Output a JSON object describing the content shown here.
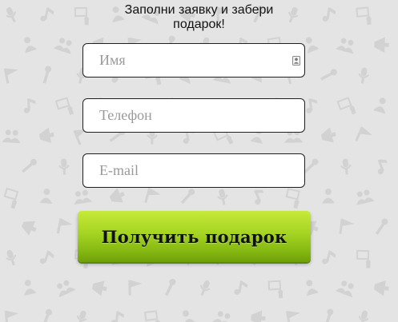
{
  "form": {
    "title_line1": "Заполни заявку и забери",
    "title_line2": "подарок!",
    "fields": {
      "name": {
        "placeholder": "Имя",
        "value": ""
      },
      "phone": {
        "placeholder": "Телефон",
        "value": ""
      },
      "email": {
        "placeholder": "E-mail",
        "value": ""
      }
    },
    "submit_label": "Получить подарок"
  },
  "icons": {
    "name_field_icon": "contact-card-icon",
    "background": "event-icons-pattern"
  },
  "colors": {
    "background": "#e4e4e4",
    "pattern": "#d2d2d2",
    "field_border": "#1f1f1f",
    "button_top": "#c7ea3a",
    "button_bottom": "#6f9f0a"
  }
}
